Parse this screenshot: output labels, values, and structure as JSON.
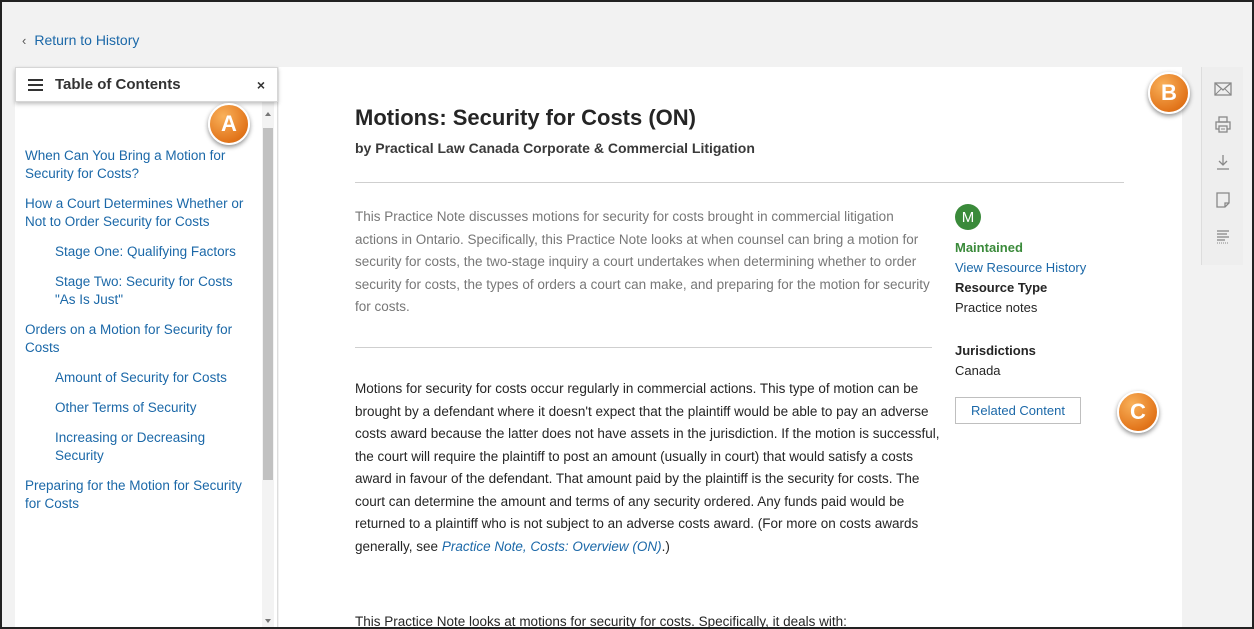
{
  "nav": {
    "return_label": "Return to History"
  },
  "toc": {
    "title": "Table of Contents",
    "close": "×",
    "items": [
      {
        "label": "When Can You Bring a Motion for Security for Costs?",
        "level": 1
      },
      {
        "label": "How a Court Determines Whether or Not to Order Security for Costs",
        "level": 1
      },
      {
        "label": "Stage One: Qualifying Factors",
        "level": 2
      },
      {
        "label": "Stage Two: Security for Costs \"As Is Just\"",
        "level": 2
      },
      {
        "label": "Orders on a Motion for Security for Costs",
        "level": 1
      },
      {
        "label": "Amount of Security for Costs",
        "level": 2
      },
      {
        "label": "Other Terms of Security",
        "level": 2
      },
      {
        "label": "Increasing or Decreasing Security",
        "level": 2
      },
      {
        "label": "Preparing for the Motion for Security for Costs",
        "level": 1
      }
    ]
  },
  "callouts": {
    "a": "A",
    "b": "B",
    "c": "C"
  },
  "document": {
    "title": "Motions: Security for Costs (ON)",
    "byline": "by Practical Law Canada Corporate & Commercial Litigation",
    "summary": "This Practice Note discusses motions for security for costs brought in commercial litigation actions in Ontario. Specifically, this Practice Note looks at when counsel can bring a motion for security for costs, the two-stage inquiry a court undertakes when determining whether to order security for costs, the types of orders a court can make, and preparing for the motion for security for costs.",
    "body_1": "Motions for security for costs occur regularly in commercial actions. This type of motion can be brought by a defendant where it doesn't expect that the plaintiff would be able to pay an adverse costs award because the latter does not have assets in the jurisdiction. If the motion is successful, the court will require the plaintiff to post an amount (usually in court) that would satisfy a costs award in favour of the defendant. That amount paid by the plaintiff is the security for costs. The court can determine the amount and terms of any security ordered. Any funds paid would be returned to a plaintiff who is not subject to an adverse costs award. (For more on costs awards generally, see ",
    "body_1_link": "Practice Note, Costs: Overview (ON)",
    "body_1_end": ".)",
    "body_2": "This Practice Note looks at motions for security for costs. Specifically, it deals with:"
  },
  "meta": {
    "status_icon": "M",
    "status": "Maintained",
    "history_link": "View Resource History",
    "resource_type_label": "Resource Type",
    "resource_type": "Practice notes",
    "jurisdictions_label": "Jurisdictions",
    "jurisdictions": "Canada",
    "related_button": "Related Content"
  },
  "toolbar": {
    "icons": [
      "email-icon",
      "print-icon",
      "download-icon",
      "annotate-icon",
      "document-outline-icon"
    ]
  },
  "colors": {
    "link": "#1b68a8",
    "maintained": "#3a8a3a",
    "callout": "#e2751b"
  }
}
